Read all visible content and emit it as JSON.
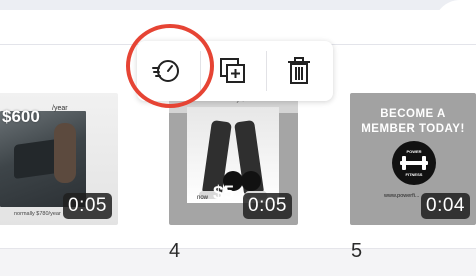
{
  "scenes": [
    {
      "name": "scene-1",
      "price": "$600",
      "price_suffix": "/year",
      "note": "normally $780/year",
      "duration": "0:05",
      "page_number": "",
      "selected": false
    },
    {
      "name": "scene-2",
      "note": "normally $75/month",
      "price": "$5",
      "price_prefix": "now",
      "duration": "0:05",
      "page_number": "4",
      "selected": true
    },
    {
      "name": "scene-3",
      "headline": "BECOME A\nMEMBER TODAY!",
      "logo_top": "POWER",
      "logo_bottom": "FITNESS",
      "url": "www.powerfi...",
      "duration": "0:04",
      "page_number": "5",
      "selected": false
    }
  ],
  "toolbar": {
    "items": [
      {
        "name": "scene-timing-icon",
        "highlighted": true
      },
      {
        "name": "duplicate-page-icon"
      },
      {
        "name": "delete-icon"
      }
    ]
  },
  "colors": {
    "highlight": "#e64434",
    "duration_bg": "#1e1e1e"
  }
}
